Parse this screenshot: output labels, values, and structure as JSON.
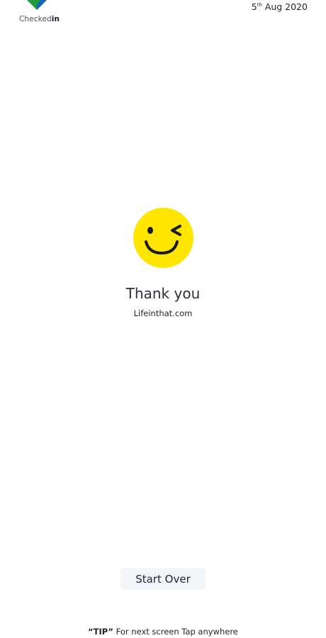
{
  "header": {
    "brand_prefix": "Checked",
    "brand_suffix": "in",
    "date_day": "5",
    "date_suffix": "th",
    "date_rest": " Aug 2020"
  },
  "main": {
    "emoji": "winking-face",
    "title": "Thank you",
    "subtitle": "Lifeinthat.com"
  },
  "actions": {
    "start_over_label": "Start Over"
  },
  "footer": {
    "tip_label": "“TIP”",
    "tip_text": " For next screen Tap anywhere"
  },
  "colors": {
    "emoji_yellow": "#FFE600",
    "logo_green": "#1E9E3A",
    "logo_blue": "#1565C0",
    "button_bg": "#F4F5F9"
  }
}
